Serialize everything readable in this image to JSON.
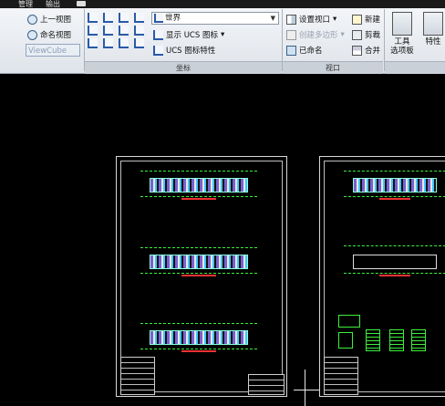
{
  "menu_tabs": [
    "管理",
    "输出"
  ],
  "view_panel": {
    "prev_view": "上一视图",
    "named_view": "命名视图",
    "viewcube": "ViewCube"
  },
  "ucs_panel": {
    "world": "世界",
    "show_ucs_icon": "显示 UCS 图标",
    "ucs_icon_props": "UCS 图标特性",
    "title": "坐标"
  },
  "viewport_panel": {
    "set_viewport": "设置视口",
    "create_polygon": "创建多边形",
    "named": "已命名",
    "new": "新建",
    "cut": "剪裁",
    "merge": "合并",
    "title": "视口"
  },
  "tools": {
    "tool_palettes_line1": "工具",
    "tool_palettes_line2": "选项板",
    "properties": "特性"
  }
}
